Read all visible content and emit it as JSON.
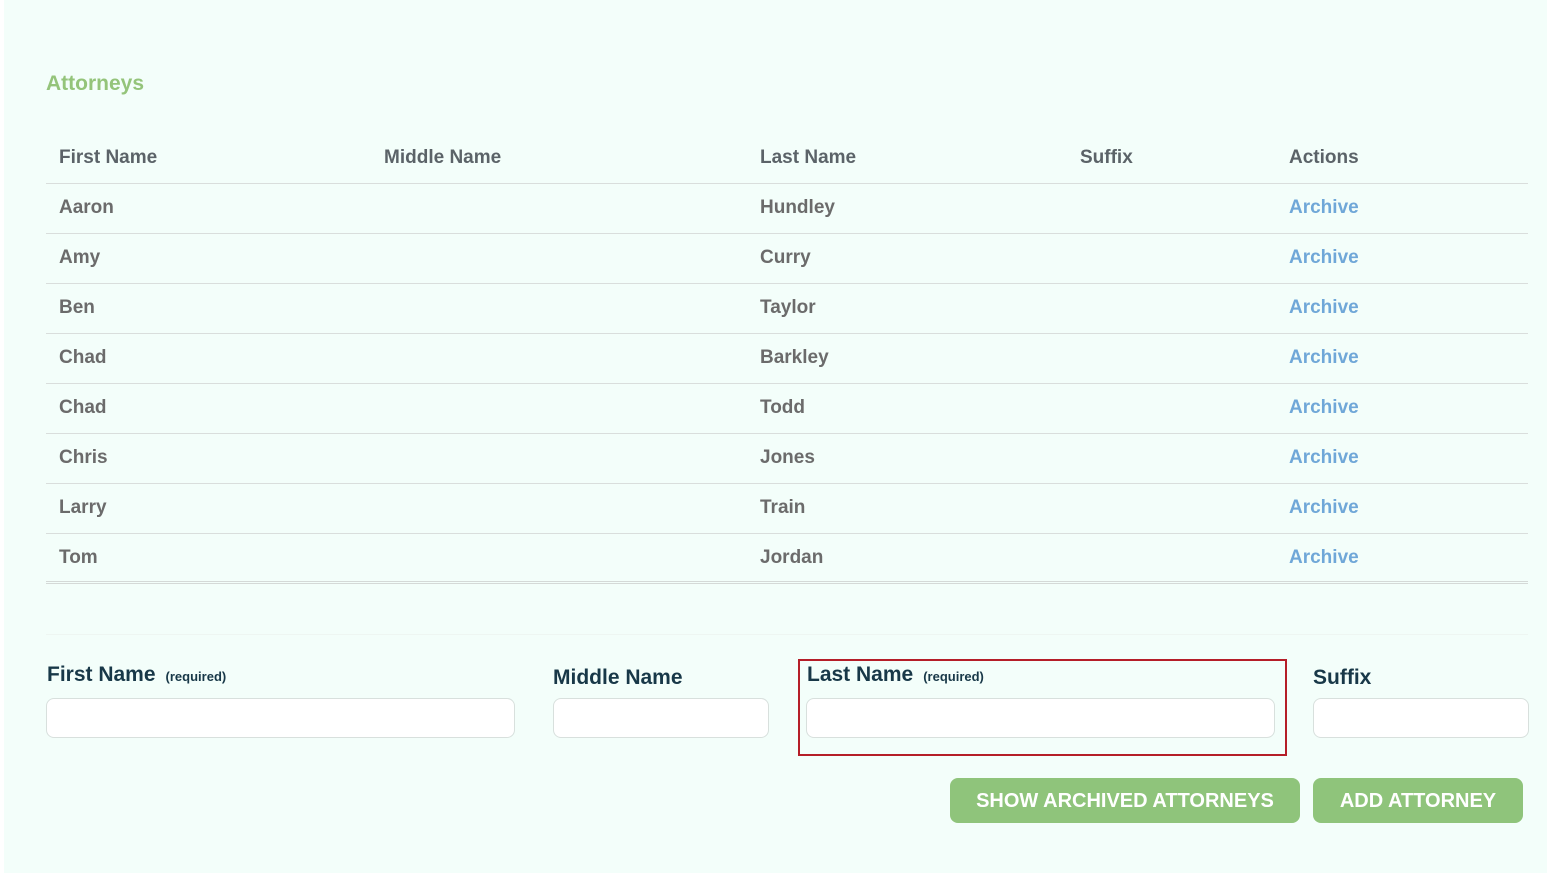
{
  "section": {
    "title": "Attorneys"
  },
  "table": {
    "headers": {
      "first_name": "First Name",
      "middle_name": "Middle Name",
      "last_name": "Last Name",
      "suffix": "Suffix",
      "actions": "Actions"
    },
    "rows": [
      {
        "first": "Aaron",
        "middle": "",
        "last": "Hundley",
        "suffix": "",
        "action": "Archive"
      },
      {
        "first": "Amy",
        "middle": "",
        "last": "Curry",
        "suffix": "",
        "action": "Archive"
      },
      {
        "first": "Ben",
        "middle": "",
        "last": "Taylor",
        "suffix": "",
        "action": "Archive"
      },
      {
        "first": "Chad",
        "middle": "",
        "last": "Barkley",
        "suffix": "",
        "action": "Archive"
      },
      {
        "first": "Chad",
        "middle": "",
        "last": "Todd",
        "suffix": "",
        "action": "Archive"
      },
      {
        "first": "Chris",
        "middle": "",
        "last": "Jones",
        "suffix": "",
        "action": "Archive"
      },
      {
        "first": "Larry",
        "middle": "",
        "last": "Train",
        "suffix": "",
        "action": "Archive"
      },
      {
        "first": "Tom",
        "middle": "",
        "last": "Jordan",
        "suffix": "",
        "action": "Archive"
      }
    ]
  },
  "form": {
    "first_name": {
      "label": "First Name",
      "required": "(required)",
      "value": ""
    },
    "middle_name": {
      "label": "Middle Name",
      "value": ""
    },
    "last_name": {
      "label": "Last Name",
      "required": "(required)",
      "value": ""
    },
    "suffix": {
      "label": "Suffix",
      "value": ""
    }
  },
  "buttons": {
    "show_archived": "SHOW ARCHIVED ATTORNEYS",
    "add_attorney": "ADD ATTORNEY"
  },
  "colors": {
    "accent_green": "#8fc47b",
    "link_blue": "#6fa7d8",
    "panel_bg": "#f3fefa",
    "highlight_red": "#b51e28"
  }
}
